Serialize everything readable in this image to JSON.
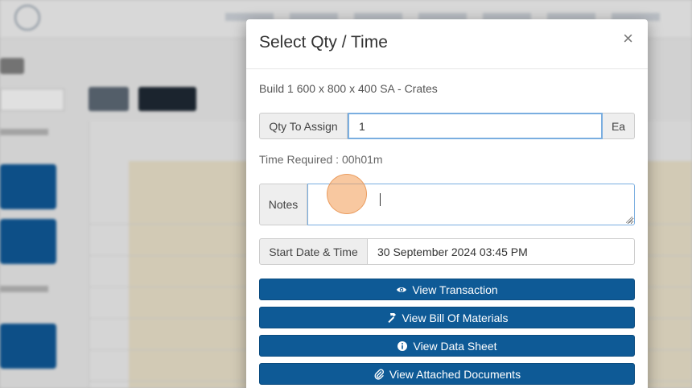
{
  "modal": {
    "title": "Select Qty / Time",
    "close_glyph": "×",
    "build_description": "Build 1 600 x 800 x 400 SA - Crates",
    "qty": {
      "label": "Qty To Assign",
      "value": "1",
      "unit": "Ea"
    },
    "time_required": "Time Required : 00h01m",
    "notes": {
      "label": "Notes",
      "value": ""
    },
    "start": {
      "label": "Start Date & Time",
      "value": "30 September 2024 03:45 PM"
    },
    "buttons": [
      {
        "label": "View Transaction",
        "icon": "eye-icon"
      },
      {
        "label": "View Bill Of Materials",
        "icon": "hammer-icon"
      },
      {
        "label": "View Data Sheet",
        "icon": "info-icon"
      },
      {
        "label": "View Attached Documents",
        "icon": "paperclip-icon"
      }
    ]
  },
  "colors": {
    "primary_button": "#0e5a96",
    "focus_border": "#7aaee0",
    "cursor_marker": "#f4a460"
  }
}
